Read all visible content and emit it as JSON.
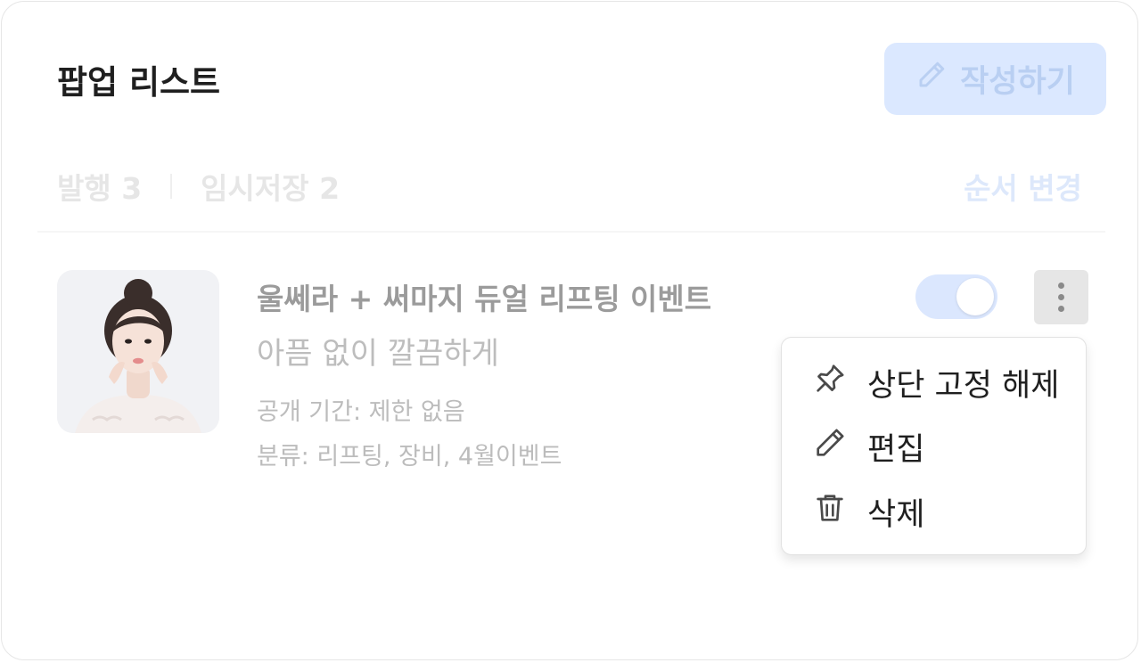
{
  "header": {
    "title": "팝업 리스트",
    "write_button": {
      "label": "작성하기",
      "icon": "pencil-icon"
    }
  },
  "tabs": [
    {
      "label": "발행 3"
    },
    {
      "label": "임시저장 2"
    }
  ],
  "reorder_label": "순서 변경",
  "popup_item": {
    "thumbnail": "woman-portrait",
    "title": "울쎄라 + 써마지 듀얼 리프팅 이벤트",
    "subtitle": "아픔 없이 깔끔하게",
    "period": "공개 기간: 제한 없음",
    "category": "분류: 리프팅, 장비, 4월이벤트",
    "toggle_on": true
  },
  "context_menu": {
    "items": [
      {
        "label": "상단 고정 해제",
        "icon": "pin-icon"
      },
      {
        "label": "편집",
        "icon": "pencil-icon"
      },
      {
        "label": "삭제",
        "icon": "trash-icon"
      }
    ]
  },
  "colors": {
    "accent_light": "#dbe8ff",
    "text_primary": "#1f1f1f",
    "text_muted": "#bcbcbc"
  }
}
